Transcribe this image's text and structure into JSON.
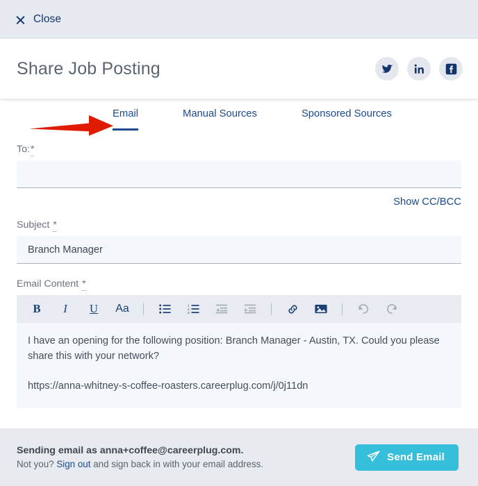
{
  "colors": {
    "accent_navy": "#1b4a8f",
    "brand_dark_navy": "#14366b",
    "send_button": "#36bfdb",
    "close_bar_bg": "#e6eaf0",
    "toolbar_bg": "#e8ecf2",
    "input_bg": "#f4f7fc",
    "footer_bg": "#e7eaee",
    "annotation_red": "#e01b00"
  },
  "close_bar": {
    "label": "Close",
    "icon": "close-x-icon"
  },
  "header": {
    "title": "Share Job Posting",
    "socials": [
      {
        "name": "twitter-icon",
        "label": "Twitter"
      },
      {
        "name": "linkedin-icon",
        "label": "LinkedIn"
      },
      {
        "name": "facebook-icon",
        "label": "Facebook"
      }
    ]
  },
  "tabs": [
    {
      "label": "Email",
      "active": true
    },
    {
      "label": "Manual Sources",
      "active": false
    },
    {
      "label": "Sponsored Sources",
      "active": false
    }
  ],
  "annotation": {
    "type": "arrow",
    "points_to": "Email",
    "color": "#e01b00"
  },
  "form": {
    "to": {
      "label": "To:",
      "required_marker": "*",
      "value": "",
      "placeholder": ""
    },
    "show_cc_bcc": "Show CC/BCC",
    "subject": {
      "label": "Subject",
      "required_marker": "*",
      "value": "Branch Manager",
      "placeholder": ""
    },
    "email_content": {
      "label": "Email Content",
      "required_marker": "*",
      "paragraph_1": "I have an opening for the following position: Branch Manager - Austin, TX. Could you please share this with your network?",
      "paragraph_2": "https://anna-whitney-s-coffee-roasters.careerplug.com/j/0j11dn"
    }
  },
  "toolbar": {
    "buttons": [
      {
        "name": "bold-icon",
        "glyph": "B",
        "enabled": true
      },
      {
        "name": "italic-icon",
        "glyph": "I",
        "enabled": true
      },
      {
        "name": "underline-icon",
        "glyph": "U",
        "enabled": true
      },
      {
        "name": "font-size-icon",
        "glyph": "Aa",
        "enabled": true
      },
      {
        "name": "bullet-list-icon",
        "glyph": "",
        "enabled": true
      },
      {
        "name": "numbered-list-icon",
        "glyph": "",
        "enabled": true
      },
      {
        "name": "outdent-icon",
        "glyph": "",
        "enabled": false
      },
      {
        "name": "indent-icon",
        "glyph": "",
        "enabled": false
      },
      {
        "name": "link-icon",
        "glyph": "",
        "enabled": true
      },
      {
        "name": "image-icon",
        "glyph": "",
        "enabled": true
      },
      {
        "name": "undo-icon",
        "glyph": "",
        "enabled": false
      },
      {
        "name": "redo-icon",
        "glyph": "",
        "enabled": false
      }
    ]
  },
  "footer": {
    "sending_as": "Sending email as anna+coffee@careerplug.com.",
    "not_you_prefix": "Not you? ",
    "sign_out_link": "Sign out",
    "not_you_suffix": " and sign back in with your email address.",
    "send_button_label": "Send Email",
    "send_icon": "paper-plane-icon"
  }
}
